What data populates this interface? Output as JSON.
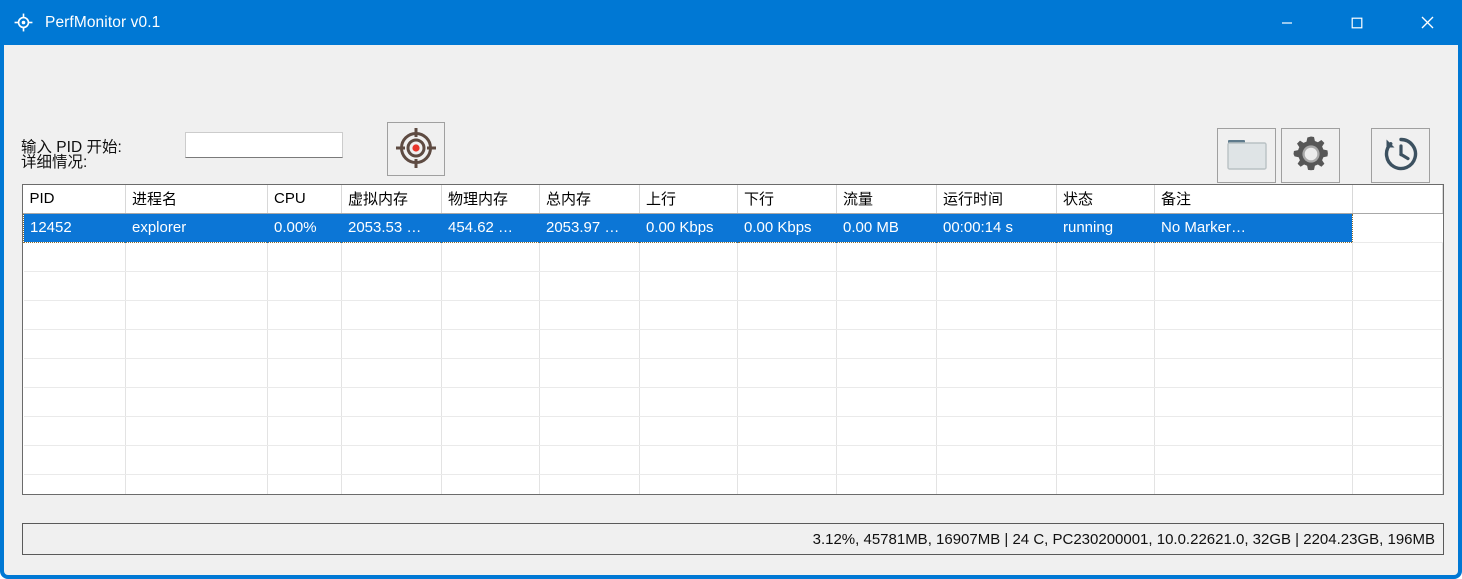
{
  "window": {
    "title": "PerfMonitor v0.1",
    "title_icon": "crosshair-target-icon",
    "accent_color": "#0078d4",
    "controls": {
      "minimize": "—",
      "maximize": "☐",
      "close": "✕"
    }
  },
  "toolbar": {
    "pid_label": "输入 PID 开始:",
    "pid_input_value": "",
    "pid_input_placeholder": "",
    "target_button": "crosshair-target-icon",
    "folder_button": "folder-icon",
    "settings_button": "gear-icon",
    "history_button": "history-clock-icon"
  },
  "detail": {
    "label": "详细情况:"
  },
  "table": {
    "columns": [
      "PID",
      "进程名",
      "CPU",
      "虚拟内存",
      "物理内存",
      "总内存",
      "上行",
      "下行",
      "流量",
      "运行时间",
      "状态",
      "备注",
      ""
    ],
    "rows": [
      {
        "selected": true,
        "cells": [
          "12452",
          "explorer",
          "0.00%",
          "2053.53 …",
          "454.62 …",
          "2053.97 …",
          "0.00 Kbps",
          "0.00 Kbps",
          "0.00 MB",
          "00:00:14 s",
          "running",
          "No Marker…",
          ""
        ]
      },
      {
        "selected": false,
        "cells": [
          "",
          "",
          "",
          "",
          "",
          "",
          "",
          "",
          "",
          "",
          "",
          "",
          ""
        ]
      },
      {
        "selected": false,
        "cells": [
          "",
          "",
          "",
          "",
          "",
          "",
          "",
          "",
          "",
          "",
          "",
          "",
          ""
        ]
      },
      {
        "selected": false,
        "cells": [
          "",
          "",
          "",
          "",
          "",
          "",
          "",
          "",
          "",
          "",
          "",
          "",
          ""
        ]
      },
      {
        "selected": false,
        "cells": [
          "",
          "",
          "",
          "",
          "",
          "",
          "",
          "",
          "",
          "",
          "",
          "",
          ""
        ]
      },
      {
        "selected": false,
        "cells": [
          "",
          "",
          "",
          "",
          "",
          "",
          "",
          "",
          "",
          "",
          "",
          "",
          ""
        ]
      },
      {
        "selected": false,
        "cells": [
          "",
          "",
          "",
          "",
          "",
          "",
          "",
          "",
          "",
          "",
          "",
          "",
          ""
        ]
      },
      {
        "selected": false,
        "cells": [
          "",
          "",
          "",
          "",
          "",
          "",
          "",
          "",
          "",
          "",
          "",
          "",
          ""
        ]
      },
      {
        "selected": false,
        "cells": [
          "",
          "",
          "",
          "",
          "",
          "",
          "",
          "",
          "",
          "",
          "",
          "",
          ""
        ]
      },
      {
        "selected": false,
        "cells": [
          "",
          "",
          "",
          "",
          "",
          "",
          "",
          "",
          "",
          "",
          "",
          "",
          ""
        ]
      }
    ]
  },
  "statusbar": {
    "text": "3.12%, 45781MB, 16907MB | 24 C, PC230200001, 10.0.22621.0, 32GB | 2204.23GB, 196MB"
  }
}
